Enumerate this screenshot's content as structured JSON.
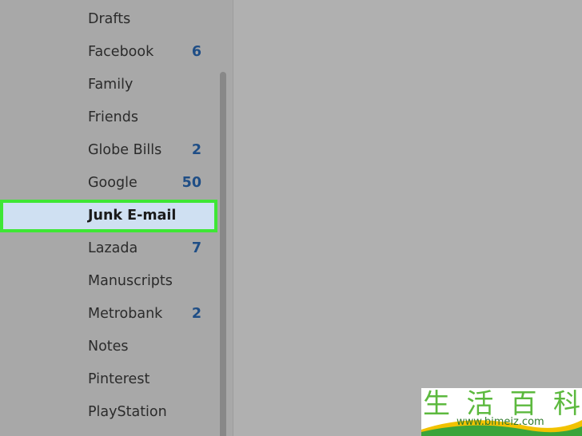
{
  "sidebar": {
    "folders": [
      {
        "label": "Drafts",
        "count": ""
      },
      {
        "label": "Facebook",
        "count": "6"
      },
      {
        "label": "Family",
        "count": ""
      },
      {
        "label": "Friends",
        "count": ""
      },
      {
        "label": "Globe Bills",
        "count": "2"
      },
      {
        "label": "Google",
        "count": "50"
      },
      {
        "label": "Junk E-mail",
        "count": "",
        "selected": true
      },
      {
        "label": "Lazada",
        "count": "7"
      },
      {
        "label": "Manuscripts",
        "count": ""
      },
      {
        "label": "Metrobank",
        "count": "2"
      },
      {
        "label": "Notes",
        "count": ""
      },
      {
        "label": "Pinterest",
        "count": ""
      },
      {
        "label": "PlayStation",
        "count": ""
      }
    ]
  },
  "watermark": {
    "chars": [
      "生",
      "活",
      "百",
      "科"
    ],
    "url": "www.bimeiz.com"
  },
  "colors": {
    "count_text": "#1f4e86",
    "selected_background": "#cfe0f2",
    "selected_outline": "#3ee635",
    "sidebar_background": "#a8a8a8",
    "main_background": "#b0b0b0"
  }
}
